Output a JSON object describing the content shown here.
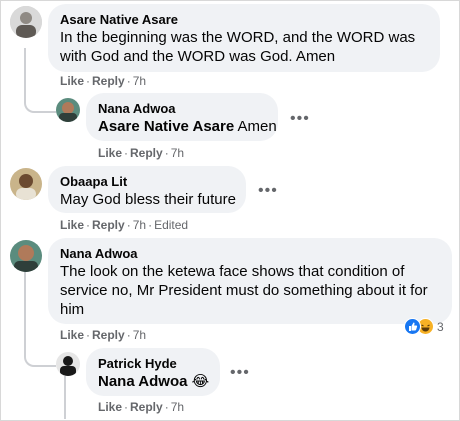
{
  "comments": [
    {
      "author": "Asare Native Asare",
      "text_lines": [
        "In the beginning was the WORD, and the WORD was",
        "with God and the WORD was God. Amen"
      ],
      "actions": {
        "like": "Like",
        "reply": "Reply",
        "time": "7h"
      }
    },
    {
      "author": "Nana Adwoa",
      "mention": "Asare Native Asare",
      "text": "Amen",
      "actions": {
        "like": "Like",
        "reply": "Reply",
        "time": "7h"
      }
    },
    {
      "author": "Obaapa Lit",
      "text": "May God bless their future",
      "actions": {
        "like": "Like",
        "reply": "Reply",
        "time": "7h",
        "edited": "Edited"
      }
    },
    {
      "author": "Nana Adwoa",
      "text_lines": [
        "The look on the ketewa face shows that condition of",
        "service no, Mr President must do something about it for",
        "him"
      ],
      "actions": {
        "like": "Like",
        "reply": "Reply",
        "time": "7h"
      },
      "reactions": {
        "types": [
          "like-icon",
          "laugh-icon"
        ],
        "count": "3"
      }
    },
    {
      "author": "Patrick Hyde",
      "mention": "Nana Adwoa",
      "emoji": "😂",
      "actions": {
        "like": "Like",
        "reply": "Reply",
        "time": "7h"
      }
    }
  ],
  "ui": {
    "separator": "·",
    "more_icon": "•••"
  },
  "colors": {
    "bubble": "#f0f2f5",
    "meta": "#65676b",
    "text": "#050505",
    "like_blue": "#1877f2",
    "haha_yellow": "#f7b125"
  }
}
